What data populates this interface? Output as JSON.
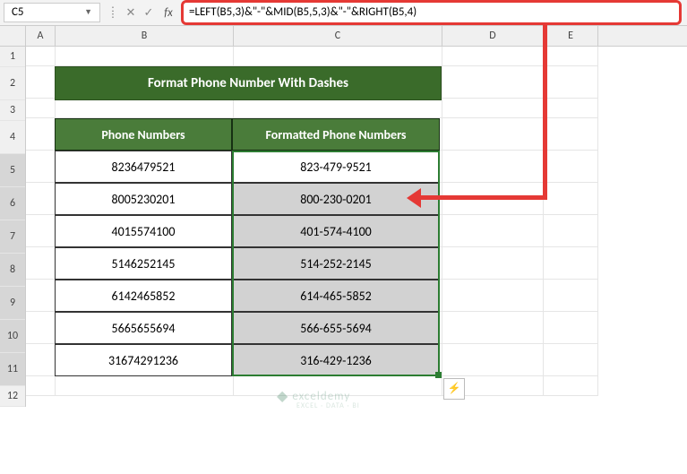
{
  "namebox": "C5",
  "fx_label": "fx",
  "formula": "=LEFT(B5,3)&\"-\"&MID(B5,5,3)&\"-\"&RIGHT(B5,4)",
  "columns": [
    "A",
    "B",
    "C",
    "D",
    "E"
  ],
  "row_numbers": [
    1,
    2,
    3,
    4,
    5,
    6,
    7,
    8,
    9,
    10,
    11,
    12
  ],
  "title": "Format Phone Number With Dashes",
  "headers": {
    "b": "Phone Numbers",
    "c": "Formatted Phone Numbers"
  },
  "rows": [
    {
      "b": "8236479521",
      "c": "823-479-9521"
    },
    {
      "b": "8005230201",
      "c": "800-230-0201"
    },
    {
      "b": "4015574100",
      "c": "401-574-4100"
    },
    {
      "b": "5146252145",
      "c": "514-252-2145"
    },
    {
      "b": "6142465852",
      "c": "614-465-5852"
    },
    {
      "b": "5665655694",
      "c": "566-655-5694"
    },
    {
      "b": "31674291236",
      "c": "316-429-1236"
    }
  ],
  "watermark": {
    "main": "exceldemy",
    "sub": "EXCEL · DATA · BI"
  },
  "icons": {
    "autofill": "⚡"
  }
}
